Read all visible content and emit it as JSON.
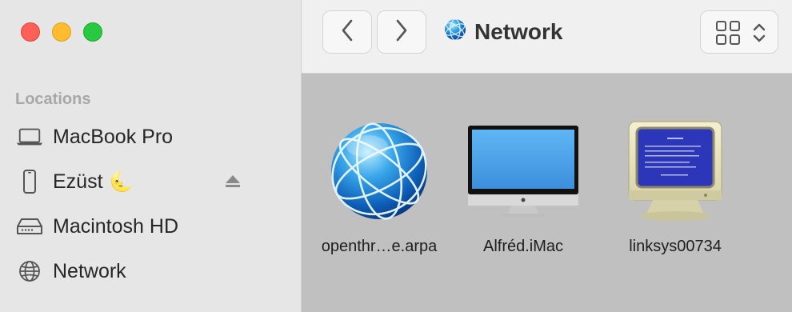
{
  "window": {
    "title": "Network"
  },
  "sidebar": {
    "section_header": "Locations",
    "items": [
      {
        "label": "MacBook Pro",
        "icon": "laptop-icon"
      },
      {
        "label": "Ezüst",
        "icon": "phone-icon",
        "badge": "🌜",
        "eject_icon": "eject-icon"
      },
      {
        "label": "Macintosh HD",
        "icon": "hard-drive-icon"
      },
      {
        "label": "Network",
        "icon": "network-globe-icon"
      }
    ]
  },
  "toolbar": {
    "back_icon": "chevron-left-icon",
    "forward_icon": "chevron-right-icon",
    "view_icon": "grid-view-icon",
    "view_stepper_icon": "chevron-up-down-icon"
  },
  "content": {
    "items": [
      {
        "name": "openthr…e.arpa",
        "icon": "network-globe-icon"
      },
      {
        "name": "Alfréd.iMac",
        "icon": "imac-icon"
      },
      {
        "name": "linksys00734",
        "icon": "crt-monitor-bsod-icon"
      }
    ]
  },
  "colors": {
    "close": "#fe5f57",
    "minimize": "#febc2e",
    "zoom": "#28c840",
    "sidebar_bg": "#e6e6e6",
    "content_bg": "#c0c0c0",
    "toolbar_bg": "#f0f0f0"
  }
}
